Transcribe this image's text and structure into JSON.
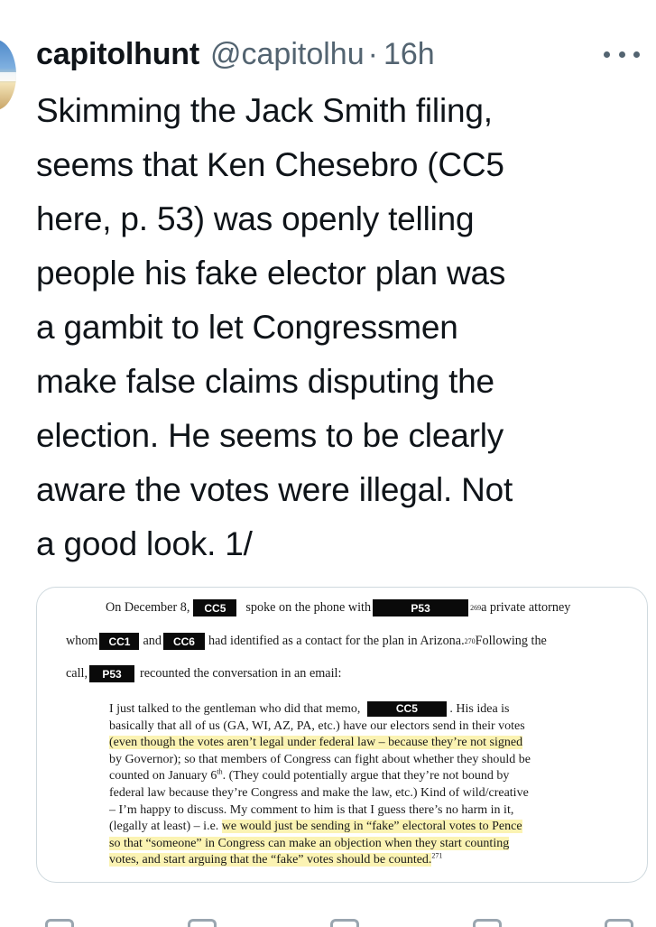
{
  "tweet": {
    "author_name": "capitolhunt",
    "handle": "@capitolhu",
    "separator": "·",
    "time": "16h",
    "text_lines": [
      "Skimming the Jack Smith filing,",
      "seems that Ken Chesebro (CC5",
      "here, p. 53) was openly telling",
      "people his fake elector plan was",
      "a gambit to let Congressmen",
      "make false claims disputing the",
      "election. He seems to be clearly",
      "aware the votes were illegal.  Not",
      "a good look. 1/"
    ]
  },
  "document": {
    "line1": {
      "a": "On December 8,",
      "redact1": "CC5",
      "b": "spoke on the phone with",
      "redact2": "P53",
      "sup": "269",
      "c": " a private attorney"
    },
    "line2": {
      "a": "whom",
      "redact1": "CC1",
      "b": "and",
      "redact2": "CC6",
      "c": "had identified as a contact for the plan in Arizona.",
      "sup": "270",
      "d": " Following the"
    },
    "line3": {
      "a": "call,",
      "redact1": "P53",
      "b": "recounted the conversation in an email:"
    },
    "quote": {
      "l1a": "I just talked to the gentleman who did that memo,",
      "l1_redact": "CC5",
      "l1b": ".  His idea is",
      "l2": "basically that all of us (GA, WI, AZ, PA, etc.) have our electors send in their votes",
      "l3": "(even though the votes aren’t legal under federal law – because they’re not signed",
      "l4": "by Governor); so that members of Congress can fight about whether they should be",
      "l5a": "counted on January 6",
      "l5_sup": "th",
      "l5b": ".  (They could potentially argue that they’re not bound by",
      "l6": "federal law because they’re Congress and make the law, etc.) Kind of wild/creative",
      "l7": "– I’m happy to discuss.  My comment to him is that I guess there’s no harm in it,",
      "l8a": "(legally at least) – i.e. ",
      "l8b": "we would just be sending in “fake” electoral votes to Pence",
      "l9": "so that “someone” in Congress can make an objection when they start counting",
      "l10": "votes, and start arguing that the “fake” votes should be counted.",
      "l10_sup": "271"
    }
  },
  "colors": {
    "text_primary": "#0f1419",
    "text_secondary": "#536471",
    "highlight": "#fbf3b3",
    "redaction": "#0a0a0a"
  },
  "icons": [
    "more-icon"
  ]
}
